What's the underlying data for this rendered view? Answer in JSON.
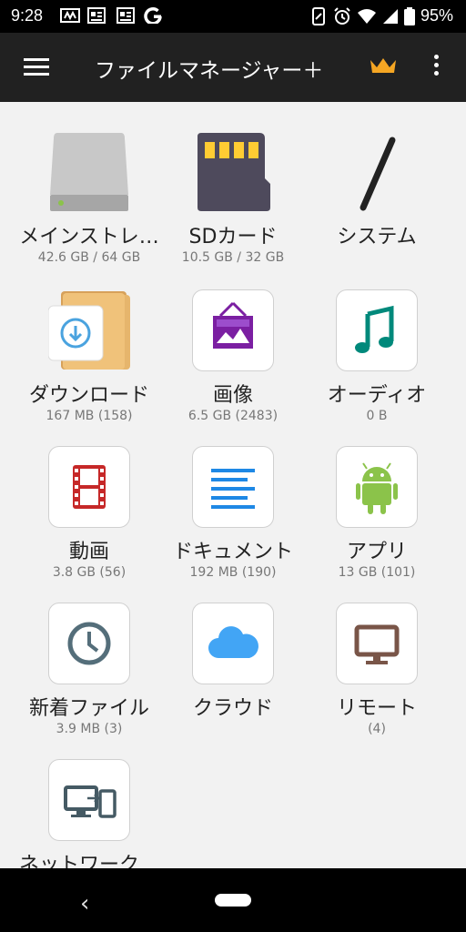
{
  "status": {
    "time": "9:28",
    "battery": "95%"
  },
  "appbar": {
    "title": "ファイルマネージャー＋"
  },
  "tiles": [
    {
      "name": "メインストレ…",
      "sub": "42.6 GB / 64 GB",
      "icon": "hard-drive-icon"
    },
    {
      "name": "SDカード",
      "sub": "10.5 GB / 32 GB",
      "icon": "sd-card-icon"
    },
    {
      "name": "システム",
      "sub": "",
      "icon": "slash-icon"
    },
    {
      "name": "ダウンロード",
      "sub": "167 MB (158)",
      "icon": "download-folder-icon"
    },
    {
      "name": "画像",
      "sub": "6.5 GB (2483)",
      "icon": "image-icon"
    },
    {
      "name": "オーディオ",
      "sub": "0 B",
      "icon": "music-note-icon"
    },
    {
      "name": "動画",
      "sub": "3.8 GB (56)",
      "icon": "film-icon"
    },
    {
      "name": "ドキュメント",
      "sub": "192 MB (190)",
      "icon": "document-lines-icon"
    },
    {
      "name": "アプリ",
      "sub": "13 GB (101)",
      "icon": "android-icon"
    },
    {
      "name": "新着ファイル",
      "sub": "3.9 MB (3)",
      "icon": "clock-icon"
    },
    {
      "name": "クラウド",
      "sub": "",
      "icon": "cloud-icon"
    },
    {
      "name": "リモート",
      "sub": "(4)",
      "icon": "monitor-icon"
    },
    {
      "name": "ネットワーク…",
      "sub": "",
      "icon": "network-devices-icon"
    }
  ],
  "colors": {
    "appbar": "#212121",
    "crown": "#f5a623",
    "image": "#7b1fa2",
    "audio": "#00897b",
    "video": "#c62828",
    "document": "#1e88e5",
    "android": "#8bc34a",
    "clock": "#546e7a",
    "cloud": "#42a5f5",
    "remote": "#795548",
    "network": "#455a64"
  }
}
